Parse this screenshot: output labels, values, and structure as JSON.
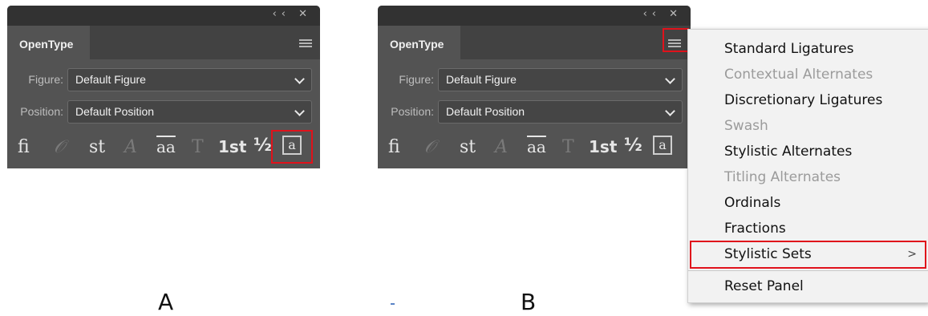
{
  "panel_a": {
    "title_icons": "‹‹  ✕",
    "tab_label": "OpenType",
    "figure_label": "Figure:",
    "figure_value": "Default Figure",
    "position_label": "Position:",
    "position_value": "Default Position",
    "glyph_fi": "fi",
    "glyph_st": "st",
    "glyph_aa": "aa",
    "glyph_1st": "1st",
    "glyph_half": "½",
    "glyph_swash": "𝒪",
    "glyph_titling": "A",
    "glyph_ordinal": "T",
    "glyph_stylistic": "a"
  },
  "panel_b": {
    "title_icons": "‹‹  ✕",
    "tab_label": "OpenType",
    "figure_label": "Figure:",
    "figure_value": "Default Figure",
    "position_label": "Position:",
    "position_value": "Default Position",
    "glyph_fi": "fi",
    "glyph_st": "st",
    "glyph_aa": "aa",
    "glyph_1st": "1st",
    "glyph_half": "½",
    "glyph_swash": "𝒪",
    "glyph_titling": "A",
    "glyph_ordinal": "T",
    "glyph_stylistic": "a"
  },
  "menu": {
    "items": [
      {
        "label": "Standard Ligatures",
        "enabled": true
      },
      {
        "label": "Contextual Alternates",
        "enabled": false
      },
      {
        "label": "Discretionary Ligatures",
        "enabled": true
      },
      {
        "label": "Swash",
        "enabled": false
      },
      {
        "label": "Stylistic Alternates",
        "enabled": true
      },
      {
        "label": "Titling Alternates",
        "enabled": false
      },
      {
        "label": "Ordinals",
        "enabled": true
      },
      {
        "label": "Fractions",
        "enabled": true
      },
      {
        "label": "Stylistic Sets",
        "enabled": true,
        "submenu_arrow": ">"
      },
      {
        "label": "Reset Panel",
        "enabled": true
      }
    ]
  },
  "captions": {
    "a": "A",
    "b": "B"
  },
  "colors": {
    "highlight": "#e0121b",
    "panel_bg": "#535353",
    "titlebar_bg": "#323232"
  }
}
